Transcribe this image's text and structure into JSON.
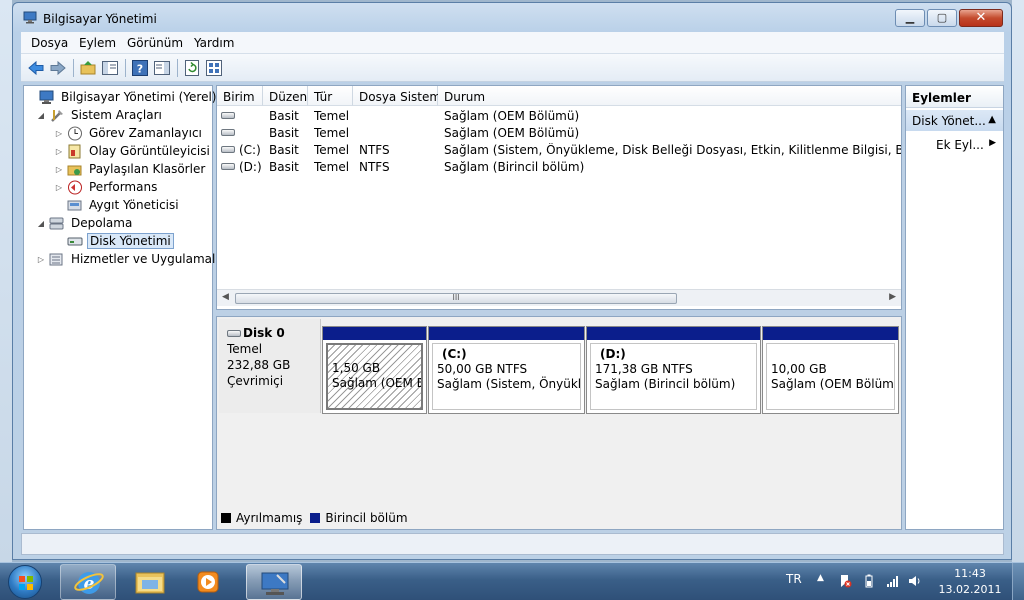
{
  "window": {
    "title": "Bilgisayar Yönetimi",
    "minimize_glyph": "▁",
    "maximize_glyph": "▢",
    "close_glyph": "✕"
  },
  "menu": [
    "Dosya",
    "Eylem",
    "Görünüm",
    "Yardım"
  ],
  "toolbar_icons": [
    "back-arrow-icon",
    "forward-arrow-icon",
    "up-folder-icon",
    "show-hide-tree-icon",
    "help-icon",
    "show-hide-action-pane-icon",
    "refresh-icon",
    "properties-icon"
  ],
  "tree": {
    "root": "Bilgisayar Yönetimi (Yerel)",
    "system_tools": "Sistem Araçları",
    "task_scheduler": "Görev Zamanlayıcı",
    "event_viewer": "Olay Görüntüleyicisi",
    "shared_folders": "Paylaşılan Klasörler",
    "performance": "Performans",
    "device_manager": "Aygıt Yöneticisi",
    "storage": "Depolama",
    "disk_management": "Disk Yönetimi",
    "services_apps": "Hizmetler ve Uygulamalar"
  },
  "volume_table": {
    "columns": [
      "Birim",
      "Düzen",
      "Tür",
      "Dosya Sistemi",
      "Durum"
    ],
    "rows": [
      {
        "volume": "",
        "layout": "Basit",
        "type": "Temel",
        "fs": "",
        "status": "Sağlam (OEM Bölümü)"
      },
      {
        "volume": "",
        "layout": "Basit",
        "type": "Temel",
        "fs": "",
        "status": "Sağlam (OEM Bölümü)"
      },
      {
        "volume": "(C:)",
        "layout": "Basit",
        "type": "Temel",
        "fs": "NTFS",
        "status": "Sağlam (Sistem, Önyükleme, Disk Belleği Dosyası, Etkin, Kilitlenme Bilgisi, Birincil bölüm"
      },
      {
        "volume": "(D:)",
        "layout": "Basit",
        "type": "Temel",
        "fs": "NTFS",
        "status": "Sağlam (Birincil bölüm)"
      }
    ],
    "scroll_left": "◀",
    "scroll_right": "▶",
    "thumb_grip": "III"
  },
  "disk": {
    "name": "Disk 0",
    "type": "Temel",
    "size": "232,88 GB",
    "state": "Çevrimiçi",
    "partitions": [
      {
        "label": "",
        "size": "1,50 GB",
        "status": "Sağlam (OEM Bölü"
      },
      {
        "label": "(C:)",
        "size": "50,00 GB NTFS",
        "status": "Sağlam (Sistem, Önyüklem"
      },
      {
        "label": "(D:)",
        "size": "171,38 GB NTFS",
        "status": "Sağlam (Birincil bölüm)"
      },
      {
        "label": "",
        "size": "10,00 GB",
        "status": "Sağlam (OEM Bölümü)"
      }
    ]
  },
  "legend": {
    "unallocated": "Ayrılmamış",
    "primary": "Birincil bölüm",
    "unallocated_color": "#000000",
    "primary_color": "#0b1e8c"
  },
  "actions": {
    "header": "Eylemler",
    "section": "Disk Yönet...",
    "more": "Ek Eyl...",
    "up_glyph": "▲",
    "right_glyph": "▶"
  },
  "taskbar": {
    "language": "TR",
    "time": "11:43",
    "date": "13.02.2011",
    "apps": [
      "internet-explorer-icon",
      "windows-explorer-icon",
      "media-player-icon",
      "computer-management-icon"
    ]
  }
}
